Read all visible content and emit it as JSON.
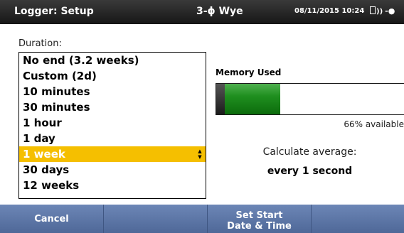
{
  "titlebar": {
    "title": "Logger: Setup",
    "mode": "3-ϕ Wye",
    "datetime": "08/11/2015 10:24"
  },
  "duration": {
    "label": "Duration:",
    "options": [
      "No end (3.2 weeks)",
      "Custom (2d)",
      "10 minutes",
      "30 minutes",
      "1 hour",
      "1 day",
      "1 week",
      "30 days",
      "12 weeks"
    ],
    "selected": "1 week"
  },
  "memory": {
    "label": "Memory Used",
    "prior_used_fraction": 0.045,
    "used_fraction": 0.34,
    "available_text": "66% available"
  },
  "average": {
    "label": "Calculate average:",
    "value": "every 1 second"
  },
  "softkeys": {
    "cancel": "Cancel",
    "blank": "",
    "set_start_line1": "Set Start",
    "set_start_line2": "Date & Time",
    "blank2": ""
  },
  "colors": {
    "selection": "#f5bf00",
    "softkey_bar": "#5b75a5",
    "memory_fill": "#1f8f1f"
  },
  "icons": [
    "battery-icon",
    "signal-icon",
    "power-plug-icon",
    "spinner-arrows-icon"
  ]
}
